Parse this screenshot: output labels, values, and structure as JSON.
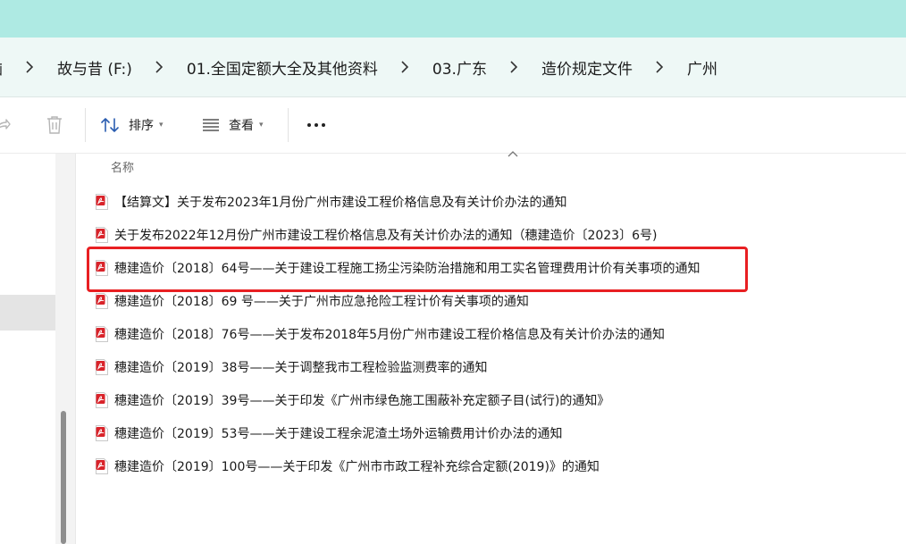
{
  "breadcrumb": [
    {
      "label": "脑"
    },
    {
      "label": "故与昔 (F:)"
    },
    {
      "label": "01.全国定额大全及其他资料"
    },
    {
      "label": "03.广东"
    },
    {
      "label": "造价规定文件"
    },
    {
      "label": "广州"
    }
  ],
  "toolbar": {
    "sort_label": "排序",
    "view_label": "查看"
  },
  "list": {
    "column_header": "名称",
    "files": [
      {
        "name": "【结算文】关于发布2023年1月份广州市建设工程价格信息及有关计价办法的通知"
      },
      {
        "name": "关于发布2022年12月份广州市建设工程价格信息及有关计价办法的通知（穗建造价〔2023〕6号)"
      },
      {
        "name": "穗建造价〔2018〕64号——关于建设工程施工扬尘污染防治措施和用工实名管理费用计价有关事项的通知"
      },
      {
        "name": "穗建造价〔2018〕69 号——关于广州市应急抢险工程计价有关事项的通知"
      },
      {
        "name": "穗建造价〔2018〕76号——关于发布2018年5月份广州市建设工程价格信息及有关计价办法的通知"
      },
      {
        "name": "穗建造价〔2019〕38号——关于调整我市工程检验监测费率的通知"
      },
      {
        "name": "穗建造价〔2019〕39号——关于印发《广州市绿色施工围蔽补充定额子目(试行)的通知》"
      },
      {
        "name": "穗建造价〔2019〕53号——关于建设工程余泥渣土场外运输费用计价办法的通知"
      },
      {
        "name": "穗建造价〔2019〕100号——关于印发《广州市市政工程补充综合定额(2019)》的通知"
      }
    ]
  },
  "colors": {
    "titlebar": "#aeeae3",
    "addressbar": "#eef8f6",
    "highlight": "#e81f22",
    "pdf_icon": "#d9232a"
  },
  "icons": [
    "chevron-right-icon",
    "share-icon",
    "delete-icon",
    "sort-icon",
    "view-icon",
    "more-icon",
    "sort-up-icon",
    "pdf-file-icon"
  ]
}
